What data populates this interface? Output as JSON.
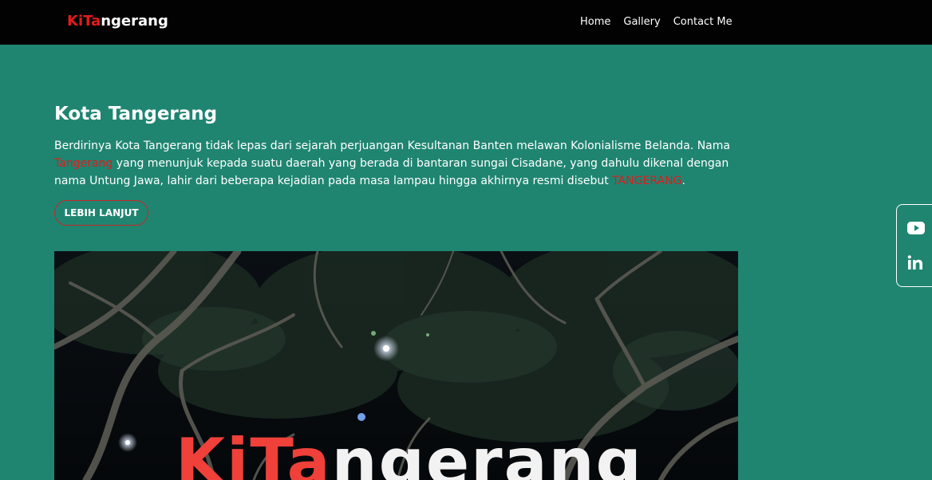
{
  "navbar": {
    "brand_part1": "KiTa",
    "brand_part2": "ngerang",
    "links": [
      "Home",
      "Gallery",
      "Contact Me"
    ]
  },
  "main": {
    "title": "Kota Tangerang",
    "desc_part1": "Berdirinya Kota Tangerang tidak lepas dari sejarah perjuangan Kesultanan Banten melawan Kolonialisme Belanda. Nama ",
    "desc_highlight1": "Tangerang",
    "desc_part2": " yang menunjuk kepada suatu daerah yang berada di bantaran sungai Cisadane, yang dahulu dikenal dengan nama Untung Jawa, lahir dari beberapa kejadian pada masa lampau hingga akhirnya resmi disebut ",
    "desc_highlight2": "TANGERANG",
    "desc_part3": ".",
    "button_label": "LEBIH LANJUT"
  },
  "hero": {
    "sign_part1": "KiTa",
    "sign_part2": "ngerang"
  },
  "social": {
    "icons": [
      "youtube-icon",
      "linkedin-icon"
    ]
  },
  "colors": {
    "background": "#1f8571",
    "navbar": "#020202",
    "accent_red": "#e21b1b",
    "button_border": "#c62828"
  }
}
